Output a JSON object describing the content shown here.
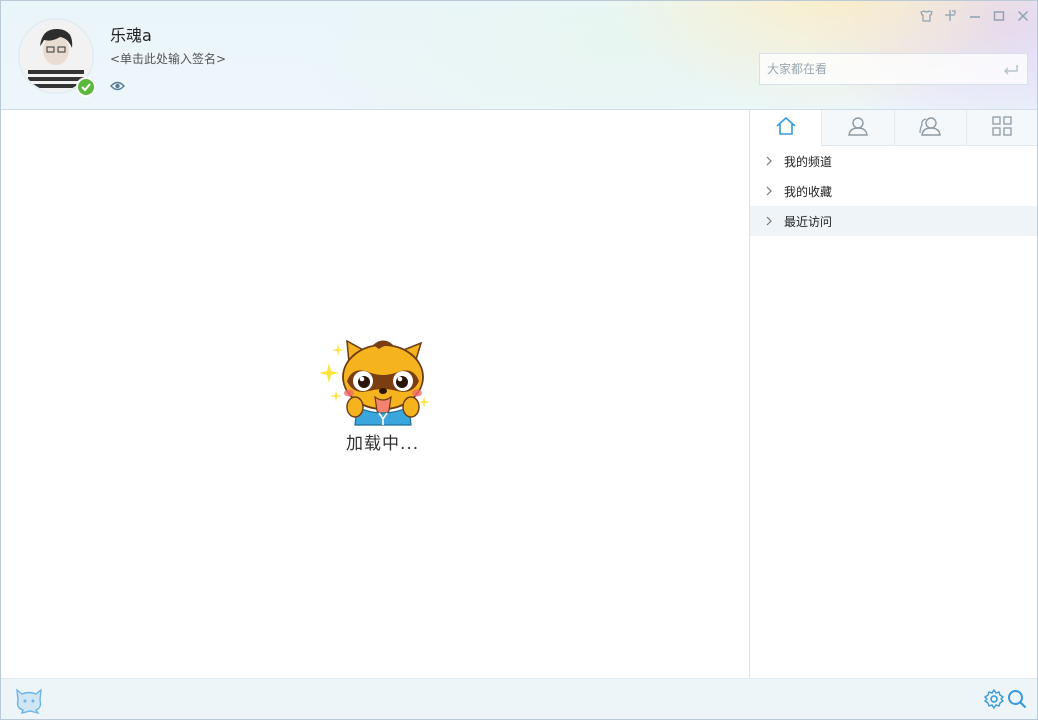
{
  "profile": {
    "username": "乐魂a",
    "signature": "<单击此处输入签名>",
    "status": "online"
  },
  "window_controls": [
    "skin-icon",
    "pin-icon",
    "minimize-icon",
    "maximize-icon",
    "close-icon"
  ],
  "search": {
    "placeholder": "大家都在看"
  },
  "main": {
    "loading_text": "加载中..."
  },
  "side": {
    "tabs": [
      {
        "icon": "home-icon",
        "active": true
      },
      {
        "icon": "person-icon",
        "active": false
      },
      {
        "icon": "friends-icon",
        "active": false
      },
      {
        "icon": "grid-icon",
        "active": false
      }
    ],
    "nav_items": [
      {
        "label": "我的频道"
      },
      {
        "label": "我的收藏"
      },
      {
        "label": "最近访问"
      }
    ]
  },
  "colors": {
    "accent": "#3a9ad9",
    "online": "#5cb83c",
    "mascot": "#f5b41e"
  }
}
